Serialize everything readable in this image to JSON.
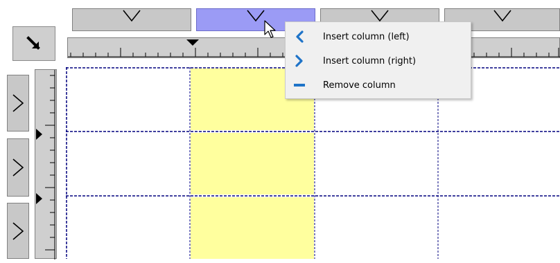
{
  "corner": {
    "icon": "arrow-down-right-icon"
  },
  "columns": [
    {
      "icon": "chevron-down-icon",
      "selected": false
    },
    {
      "icon": "chevron-down-icon",
      "selected": true
    },
    {
      "icon": "chevron-down-icon",
      "selected": false
    },
    {
      "icon": "chevron-down-icon",
      "selected": false
    }
  ],
  "rows": [
    {
      "icon": "chevron-right-icon"
    },
    {
      "icon": "chevron-right-icon"
    },
    {
      "icon": "chevron-right-icon"
    }
  ],
  "grid": {
    "selected_column": 2,
    "selection_color": "#ffff9e",
    "grid_line_color": "#00007f"
  },
  "context_menu": {
    "items": [
      {
        "label": "Insert column (left)",
        "icon": "chevron-left-icon"
      },
      {
        "label": "Insert column (right)",
        "icon": "chevron-right-icon"
      },
      {
        "label": "Remove column",
        "icon": "minus-icon"
      }
    ],
    "icon_color": "#1e73c8"
  },
  "colors": {
    "header_gray": "#c8c8c8",
    "header_selected": "#9b9bf5"
  }
}
